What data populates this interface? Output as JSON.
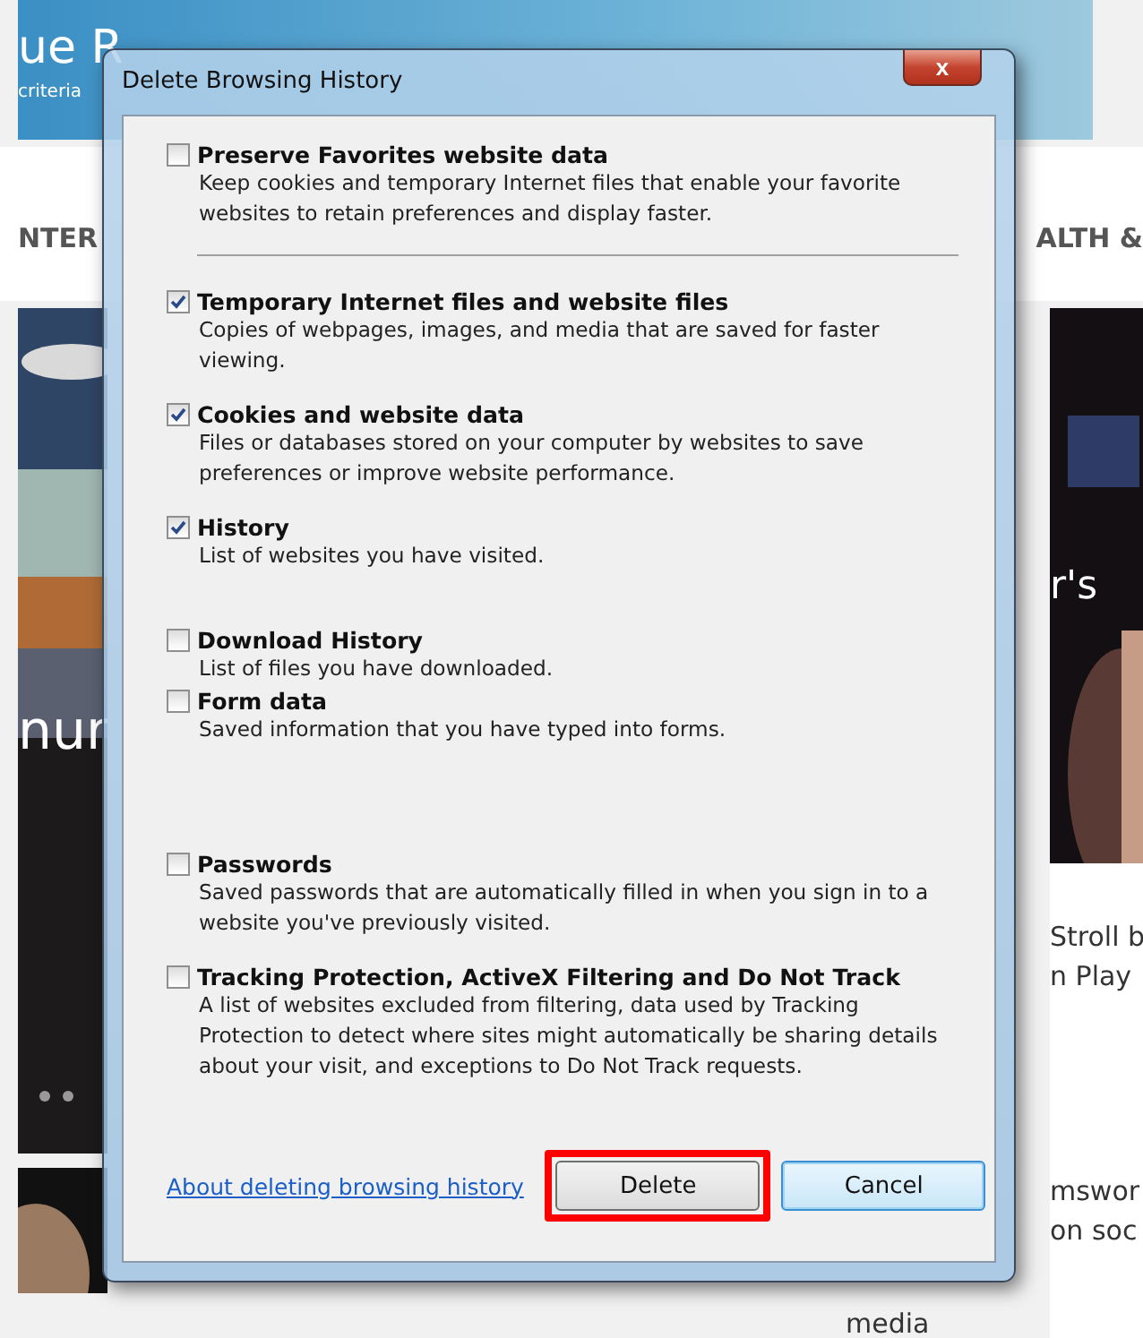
{
  "background_page": {
    "banner_title": "ue R",
    "banner_subtitle": "criteria",
    "nav_left": "NTER",
    "nav_right": "ALTH &",
    "left_caption": "nur",
    "right_caption": "r's",
    "right_story": [
      "Stroll b",
      "n Play"
    ],
    "right_story_2": [
      "mswor",
      "on soc"
    ],
    "bottom_caption": "media"
  },
  "dialog": {
    "title": "Delete Browsing History",
    "close_label": "x",
    "options": [
      {
        "label": "Preserve Favorites website data",
        "description": "Keep cookies and temporary Internet files that enable your favorite websites to retain preferences and display faster.",
        "checked": false
      },
      {
        "label": "Temporary Internet files and website files",
        "description": "Copies of webpages, images, and media that are saved for faster viewing.",
        "checked": true
      },
      {
        "label": "Cookies and website data",
        "description": "Files or databases stored on your computer by websites to save preferences or improve website performance.",
        "checked": true
      },
      {
        "label": "History",
        "description": "List of websites you have visited.",
        "checked": true
      },
      {
        "label": "Download History",
        "description": "List of files you have downloaded.",
        "checked": false
      },
      {
        "label": "Form data",
        "description": "Saved information that you have typed into forms.",
        "checked": false
      },
      {
        "label": "Passwords",
        "description": "Saved passwords that are automatically filled in when you sign in to a website you've previously visited.",
        "checked": false
      },
      {
        "label": "Tracking Protection, ActiveX Filtering and Do Not Track",
        "description": "A list of websites excluded from filtering, data used by Tracking Protection to detect where sites might automatically be sharing details about your visit, and exceptions to Do Not Track requests.",
        "checked": false
      }
    ],
    "help_link": "About deleting browsing history",
    "buttons": [
      {
        "label": "Delete",
        "highlighted": true,
        "default": false
      },
      {
        "label": "Cancel",
        "highlighted": false,
        "default": true
      }
    ]
  }
}
